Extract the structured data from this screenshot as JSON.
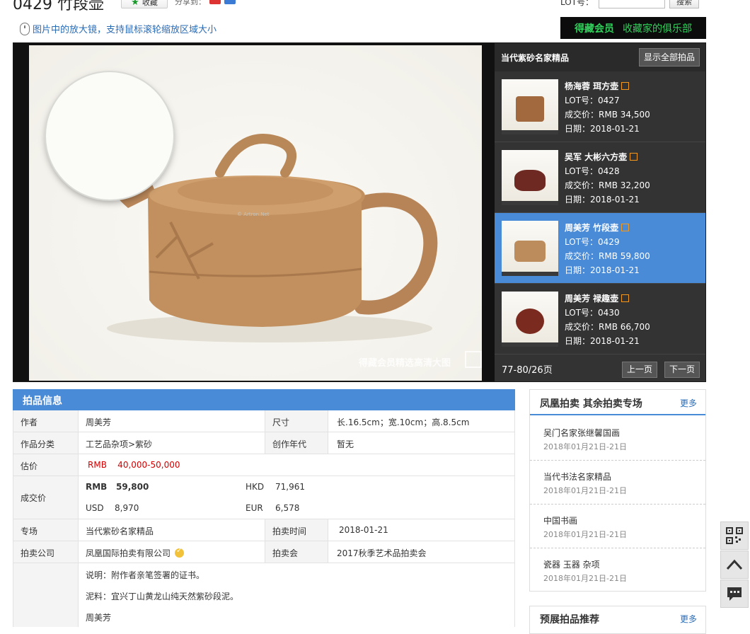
{
  "page": {
    "title": "0429 竹段壶",
    "favorite_label": "收藏",
    "share_label": "分享到：",
    "lot_label": "LOT号：",
    "search_label": "搜索",
    "magnifier_tip": "图片中的放大镜，支持鼠标滚轮缩放区域大小",
    "club_banner": {
      "left": "得藏会员",
      "right": "收藏家的俱乐部"
    }
  },
  "viewer": {
    "watermark_center": "© Artron.Net",
    "watermark_bottom": "得藏会员精选高清大图"
  },
  "side_panel": {
    "title": "当代紫砂名家精品",
    "show_all": "显示全部拍品",
    "items": [
      {
        "name": "杨海蓉  珥方壶",
        "lot": "LOT号：0427",
        "price": "成交价：RMB 34,500",
        "date": "日期：2018-01-21",
        "active": false
      },
      {
        "name": "吴军  大彬六方壶",
        "lot": "LOT号：0428",
        "price": "成交价：RMB 32,200",
        "date": "日期：2018-01-21",
        "active": false
      },
      {
        "name": "周美芳  竹段壶",
        "lot": "LOT号：0429",
        "price": "成交价：RMB 59,800",
        "date": "日期：2018-01-21",
        "active": true
      },
      {
        "name": "周美芳  禄趣壶",
        "lot": "LOT号：0430",
        "price": "成交价：RMB 66,700",
        "date": "日期：2018-01-21",
        "active": false
      }
    ],
    "page_info": "77-80/26页",
    "prev": "上一页",
    "next": "下一页"
  },
  "info": {
    "heading": "拍品信息",
    "author_label": "作者",
    "author": "周美芳",
    "size_label": "尺寸",
    "size": "长.16.5cm；宽.10cm；高.8.5cm",
    "category_label": "作品分类",
    "category": "工艺品杂项>紫砂",
    "era_label": "创作年代",
    "era": "暂无",
    "estimate_label": "估价",
    "estimate": "RMB    40,000-50,000",
    "sold_label": "成交价",
    "sold_rmb_cur": "RMB",
    "sold_rmb": "59,800",
    "sold_hkd_cur": "HKD",
    "sold_hkd": "71,961",
    "sold_usd_cur": "USD",
    "sold_usd": "8,970",
    "sold_eur_cur": "EUR",
    "sold_eur": "6,578",
    "session_label": "专场",
    "session": "当代紫砂名家精品",
    "time_label": "拍卖时间",
    "time": "2018-01-21",
    "company_label": "拍卖公司",
    "company": "凤凰国际拍卖有限公司",
    "auction_label": "拍卖会",
    "auction": "2017秋季艺术品拍卖会",
    "desc1": "说明：附作者亲笔签署的证书。",
    "desc2": "泥料：宜兴丁山黄龙山纯天然紫砂段泥。",
    "desc3": "周美芳"
  },
  "right": {
    "title": "凤凰拍卖  其余拍卖专场",
    "more": "更多",
    "items": [
      {
        "name": "吴门名家张继馨国画",
        "date": "2018年01月21日-21日"
      },
      {
        "name": "当代书法名家精品",
        "date": "2018年01月21日-21日"
      },
      {
        "name": "中国书画",
        "date": "2018年01月21日-21日"
      },
      {
        "name": "瓷器  玉器  杂项",
        "date": "2018年01月21日-21日"
      }
    ],
    "title2": "预展拍品推荐",
    "more2": "更多"
  },
  "colors": {
    "accent": "#4a8bd8",
    "club_green": "#2fd35a",
    "estimate_red": "#d40000",
    "clay": "#c1905e"
  },
  "icons": [
    "mouse-icon",
    "star-icon",
    "qr-code-icon",
    "back-to-top-icon",
    "feedback-icon",
    "external-link-icon",
    "verified-badge-icon"
  ]
}
